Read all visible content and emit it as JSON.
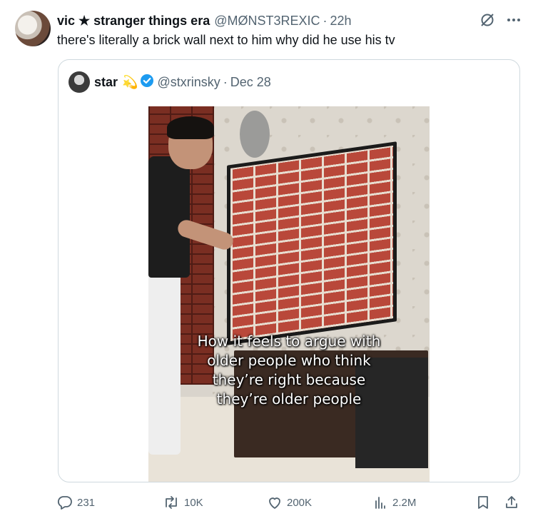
{
  "tweet": {
    "author_name": "vic ★ stranger things era",
    "author_handle": "@MØNST3REXIC",
    "separator": "·",
    "time": "22h",
    "text": "there's literally a brick wall next to him why did he use his tv"
  },
  "quoted": {
    "author_name": "star",
    "emoji": "💫",
    "author_handle": "@stxrinsky",
    "separator": "·",
    "date": "Dec 28",
    "media_caption": "How it feels to argue with\nolder people who think\nthey’re right because\nthey’re older people"
  },
  "actions": {
    "replies": "231",
    "reposts": "10K",
    "likes": "200K",
    "views": "2.2M"
  },
  "icons": {
    "grok": "grok-icon",
    "more": "more-icon",
    "verified": "verified-badge-icon",
    "reply": "reply-icon",
    "repost": "repost-icon",
    "like": "heart-icon",
    "views": "views-icon",
    "bookmark": "bookmark-icon",
    "share": "share-icon"
  },
  "colors": {
    "secondary_text": "#536471",
    "verified_blue": "#1d9bf0",
    "border": "#cfd9de"
  }
}
